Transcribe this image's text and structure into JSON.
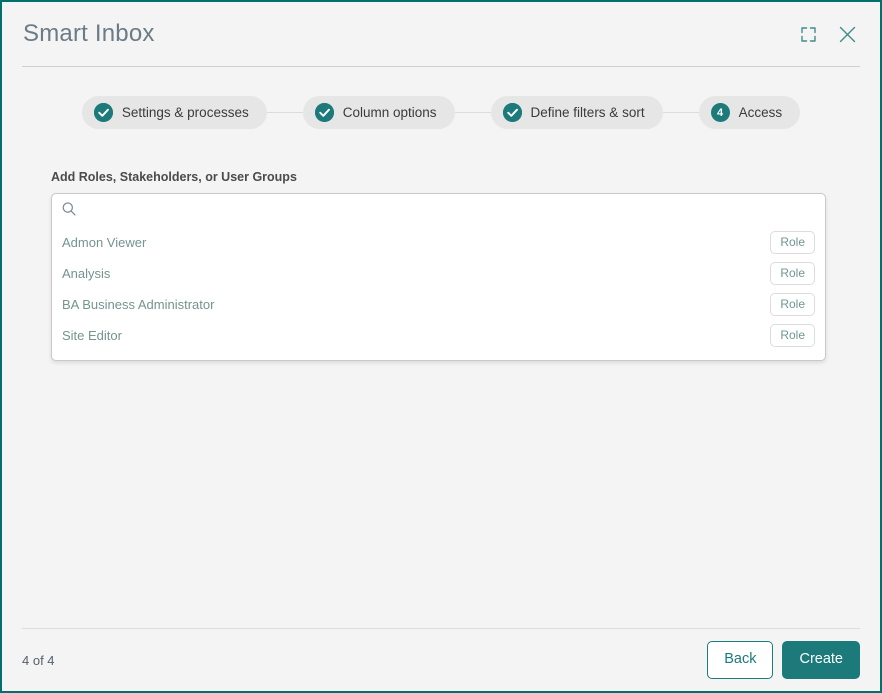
{
  "window": {
    "title": "Smart Inbox",
    "accent_color": "#1c7a7a",
    "border_color": "#04706e",
    "background_color": "#f4f4f4"
  },
  "header": {
    "expand_icon": "expand-icon",
    "close_icon": "close-icon"
  },
  "stepper": {
    "steps": [
      {
        "label": "Settings & processes",
        "badge": "check",
        "number": "1",
        "state": "completed"
      },
      {
        "label": "Column options",
        "badge": "check",
        "number": "2",
        "state": "completed"
      },
      {
        "label": "Define filters & sort",
        "badge": "check",
        "number": "3",
        "state": "completed"
      },
      {
        "label": "Access",
        "badge": "number",
        "number": "4",
        "state": "current"
      }
    ]
  },
  "main": {
    "field_label": "Add Roles, Stakeholders, or User Groups",
    "search": {
      "icon": "search-icon",
      "value": "",
      "placeholder": ""
    },
    "suggestions": [
      {
        "name": "Admon Viewer",
        "tag": "Role"
      },
      {
        "name": "Analysis",
        "tag": "Role"
      },
      {
        "name": "BA Business Administrator",
        "tag": "Role"
      },
      {
        "name": "Site Editor",
        "tag": "Role"
      }
    ]
  },
  "footer": {
    "page_count": "4 of 4",
    "back_label": "Back",
    "create_label": "Create"
  }
}
